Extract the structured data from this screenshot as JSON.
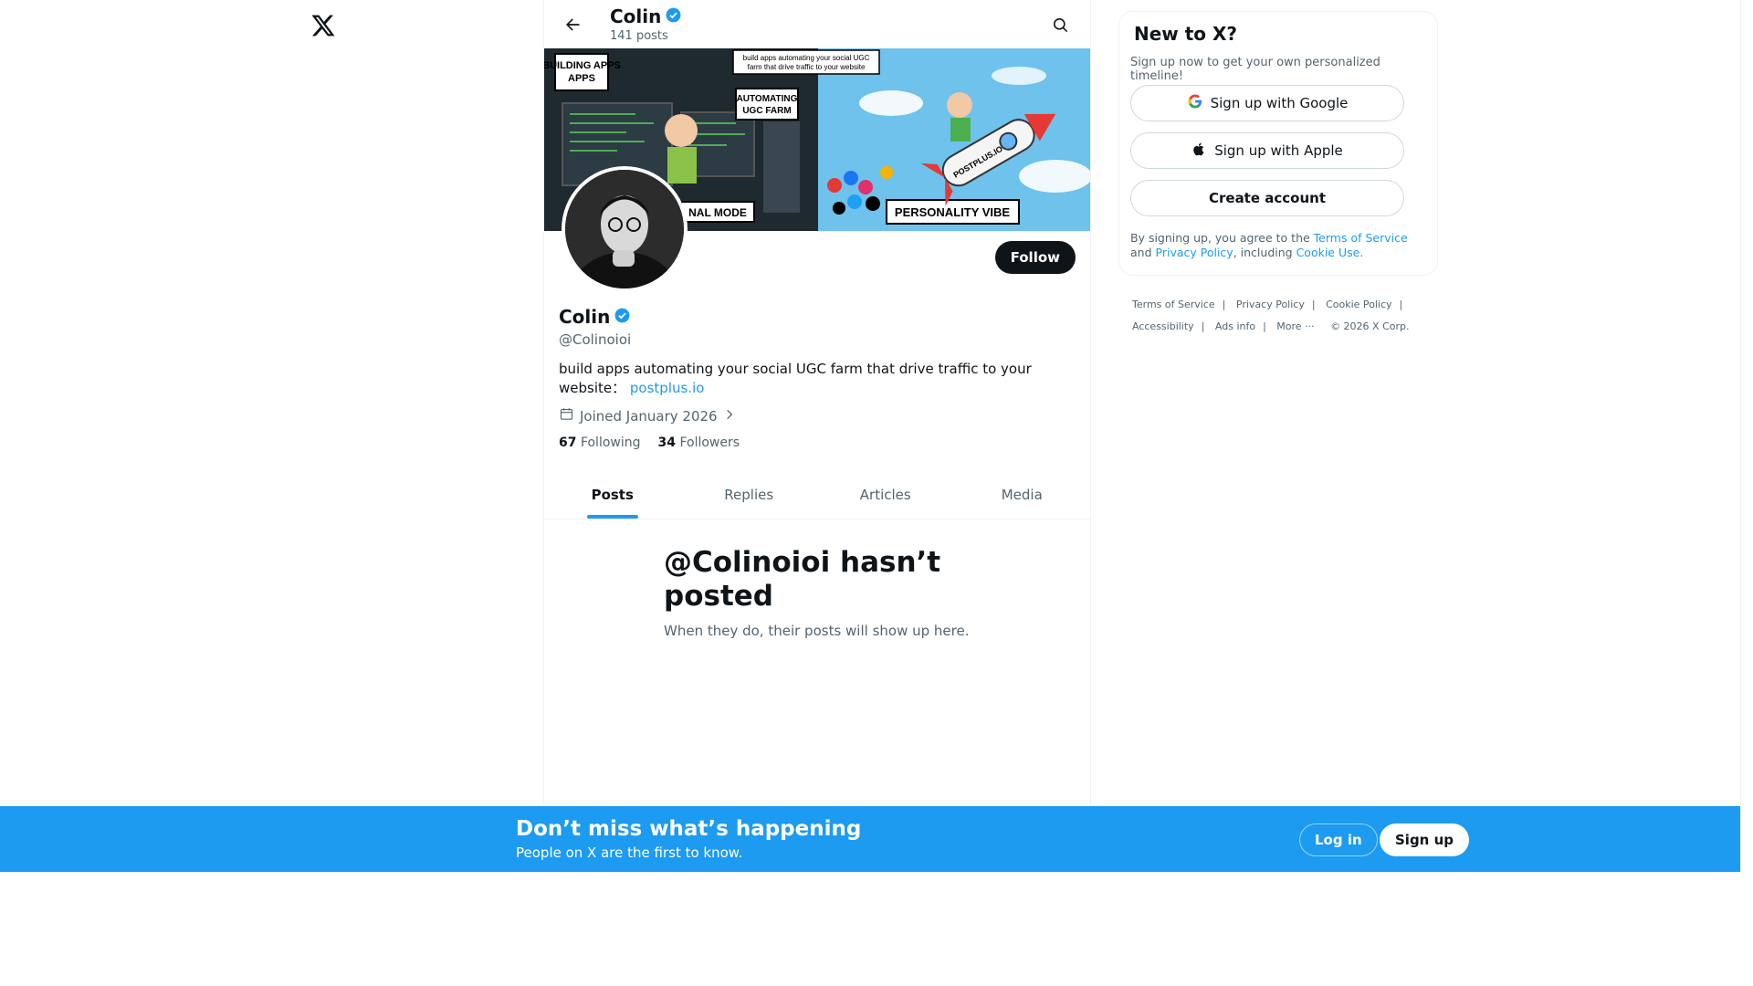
{
  "header": {
    "name": "Colin",
    "posts_count": "141 posts"
  },
  "banner": {
    "labels": [
      "BUILDING APPS",
      "build apps automating your social UGC farm that drive traffic to your website",
      "AUTOMATING UGC FARM",
      "NAL MODE",
      "PERSONALITY VIBE",
      "POSTPLUS.IO"
    ]
  },
  "profile": {
    "name": "Colin",
    "handle": "@Colinoioi",
    "bio_text": "build apps automating your social UGC farm that drive traffic to your website：",
    "bio_link": "postplus.io",
    "joined": "Joined January 2026",
    "following_count": "67",
    "following_label": "Following",
    "followers_count": "34",
    "followers_label": "Followers",
    "follow_button": "Follow"
  },
  "tabs": [
    "Posts",
    "Replies",
    "Articles",
    "Media"
  ],
  "empty_state": {
    "title": "@Colinoioi hasn’t posted",
    "subtitle": "When they do, their posts will show up here."
  },
  "signup_box": {
    "title": "New to X?",
    "subtitle": "Sign up now to get your own personalized timeline!",
    "google": "Sign up with Google",
    "apple": "Sign up with Apple",
    "create": "Create account",
    "terms_prefix": "By signing up, you agree to the",
    "terms_link": "Terms of Service",
    "terms_and": "and",
    "privacy_link": "Privacy Policy",
    "including": ", including",
    "cookie_link": "Cookie Use."
  },
  "footer": {
    "links": [
      "Terms of Service",
      "Privacy Policy",
      "Cookie Policy",
      "Accessibility",
      "Ads info",
      "More ···"
    ],
    "copyright": "© 2026 X Corp."
  },
  "bottom_bar": {
    "title": "Don’t miss what’s happening",
    "subtitle": "People on X are the first to know.",
    "login": "Log in",
    "signup": "Sign up"
  },
  "colors": {
    "accent": "#1d9bf0",
    "text": "#0f1419",
    "muted": "#536471"
  }
}
